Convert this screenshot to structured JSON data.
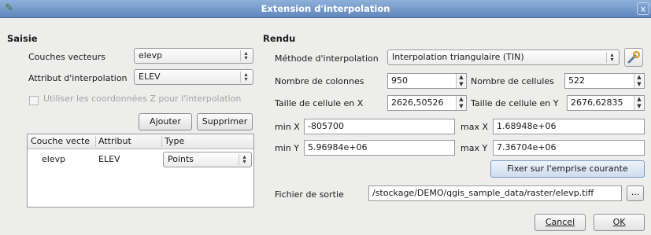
{
  "window": {
    "title": "Extension d'interpolation",
    "close": "x"
  },
  "saisie": {
    "header": "Saisie",
    "layer_label": "Couches vecteurs",
    "layer_value": "elevp",
    "attr_label": "Attribut d'interpolation",
    "attr_value": "ELEV",
    "use_z_label": "Utiliser les coordonnées Z pour l'interpolation",
    "add_button": "Ajouter",
    "remove_button": "Supprimer",
    "table": {
      "columns": [
        "Couche vecte",
        "Attribut",
        "Type"
      ],
      "rows": [
        {
          "layer": "elevp",
          "attribute": "ELEV",
          "type": "Points"
        }
      ]
    }
  },
  "rendu": {
    "header": "Rendu",
    "method_label": "Méthode d'interpolation",
    "method_value": "Interpolation triangulaire (TIN)",
    "cols_label": "Nombre de colonnes",
    "cols_value": "950",
    "cells_label": "Nombre de cellules",
    "cells_value": "522",
    "cellx_label": "Taille de cellule en X",
    "cellx_value": "2626,50526",
    "celly_label": "Taille de cellule en Y",
    "celly_value": "2676,62835",
    "minx_label": "min X",
    "minx_value": "-805700",
    "maxx_label": "max X",
    "maxx_value": "1.68948e+06",
    "miny_label": "min Y",
    "miny_value": "5.96984e+06",
    "maxy_label": "max Y",
    "maxy_value": "7.36704e+06",
    "extent_button": "Fixer sur l'emprise courante",
    "output_label": "Fichier de sortie",
    "output_value": "/stockage/DEMO/qgis_sample_data/raster/elevp.tiff",
    "browse_button": "..."
  },
  "footer": {
    "cancel": "Cancel",
    "ok": "OK"
  }
}
